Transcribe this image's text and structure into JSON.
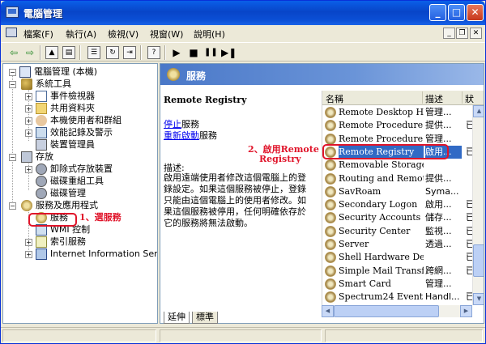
{
  "window": {
    "title": "電腦管理"
  },
  "menu": {
    "file": "檔案(F)",
    "action": "執行(A)",
    "view": "檢視(V)",
    "window": "視窗(W)",
    "help": "說明(H)"
  },
  "tree": {
    "root": "電腦管理 (本機)",
    "system_tools": "系統工具",
    "event_viewer": "事件檢視器",
    "shared_folders": "共用資料夾",
    "local_users": "本機使用者和群組",
    "perf_logs": "效能記錄及警示",
    "device_manager": "裝置管理員",
    "storage": "存放",
    "removable_storage": "卸除式存放裝置",
    "defrag": "磁碟重組工具",
    "disk_mgmt": "磁碟管理",
    "services_apps": "服務及應用程式",
    "services": "服務",
    "wmi": "WMI 控制",
    "indexing": "索引服務",
    "iis": "Internet Information Services"
  },
  "annotations": {
    "left": "1、選服務",
    "right_line1": "2、啟用Remote",
    "right_line2": "Registry"
  },
  "right": {
    "header_title": "服務",
    "service_title": "Remote Registry",
    "stop_link": "停止",
    "stop_suffix": "服務",
    "restart_link": "重新啟動",
    "restart_suffix": "服務",
    "desc_label": "描述:",
    "desc_text": "啟用遠端使用者修改這個電腦上的登錄設定。如果這個服務被停止，登錄只能由這個電腦上的使用者修改。如果這個服務被停用，任何明確依存於它的服務將無法啟動。"
  },
  "list": {
    "columns": {
      "name": "名稱",
      "desc": "描述",
      "status": "狀"
    },
    "rows": [
      {
        "name": "Remote Desktop Hel...",
        "desc": "管理...",
        "status": ""
      },
      {
        "name": "Remote Procedure C...",
        "desc": "提供...",
        "status": "已"
      },
      {
        "name": "Remote Procedure C...",
        "desc": "管理...",
        "status": ""
      },
      {
        "name": "Remote Registry",
        "desc": "啟用...",
        "status": "已"
      },
      {
        "name": "Removable Storage",
        "desc": "",
        "status": ""
      },
      {
        "name": "Routing and Remote...",
        "desc": "提供...",
        "status": ""
      },
      {
        "name": "SavRoam",
        "desc": "Syma...",
        "status": ""
      },
      {
        "name": "Secondary Logon",
        "desc": "啟用...",
        "status": "已"
      },
      {
        "name": "Security Accounts M...",
        "desc": "儲存...",
        "status": "已"
      },
      {
        "name": "Security Center",
        "desc": "監視...",
        "status": "已"
      },
      {
        "name": "Server",
        "desc": "透過...",
        "status": "已"
      },
      {
        "name": "Shell Hardware Dete...",
        "desc": "",
        "status": "已"
      },
      {
        "name": "Simple Mail Transfer...",
        "desc": "跨網...",
        "status": "已"
      },
      {
        "name": "Smart Card",
        "desc": "管理...",
        "status": ""
      },
      {
        "name": "Spectrum24 Event M...",
        "desc": "Handl...",
        "status": "已"
      }
    ]
  },
  "tabs": {
    "extended": "延伸",
    "standard": "標準"
  }
}
